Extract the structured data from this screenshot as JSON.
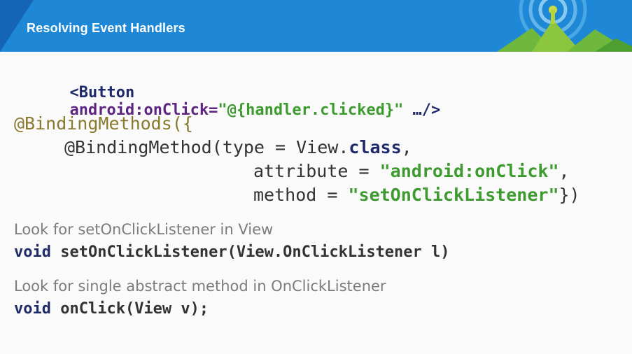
{
  "header": {
    "title": "Resolving Event Handlers"
  },
  "xml_line": {
    "open": "<Button",
    "attr": "android:onClick=",
    "value": "\"@{handler.clicked}\"",
    "end": " …/>"
  },
  "annotation": {
    "line1": "@BindingMethods({",
    "line2_a": "@BindingMethod(type = View.",
    "line2_kw": "class",
    "line2_b": ",",
    "line3_a": "attribute = ",
    "line3_str": "\"android:onClick\"",
    "line3_b": ",",
    "line4_a": "method = ",
    "line4_str": "\"setOnClickListener\"",
    "line4_b": "})"
  },
  "note1": {
    "text": "Look for setOnClickListener in View",
    "code_kw": "void",
    "code_rest": " setOnClickListener(View.OnClickListener l)"
  },
  "note2": {
    "text": "Look for single abstract method in OnClickListener",
    "code_kw": "void",
    "code_rest": " onClick(View v);"
  },
  "colors": {
    "header": "#1e88d6",
    "purple": "#5e2481",
    "olive": "#8a7a30",
    "green": "#3d9a2e",
    "navy": "#1f2a68"
  }
}
